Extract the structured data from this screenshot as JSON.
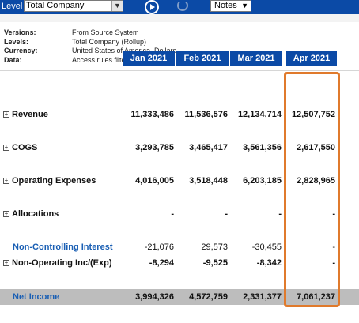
{
  "toolbar": {
    "level_label": "Level",
    "level_value": "Total Company",
    "notes_value": "Notes"
  },
  "meta": {
    "versions_key": "Versions:",
    "versions_val": "From Source System",
    "levels_key": "Levels:",
    "levels_val": "Total Company (Rollup)",
    "currency_key": "Currency:",
    "currency_val": "United States of America, Dollars",
    "data_key": "Data:",
    "data_val": "Access rules filter your data."
  },
  "columns": [
    "Jan 2021",
    "Feb 2021",
    "Mar 2021",
    "Apr 2021"
  ],
  "rows": [
    {
      "label": "Revenue",
      "values": [
        "11,333,486",
        "11,536,576",
        "12,134,714",
        "12,507,752"
      ]
    },
    {
      "label": "COGS",
      "values": [
        "3,293,785",
        "3,465,417",
        "3,561,356",
        "2,617,550"
      ]
    },
    {
      "label": "Operating Expenses",
      "values": [
        "4,016,005",
        "3,518,448",
        "6,203,185",
        "2,828,965"
      ]
    },
    {
      "label": "Allocations",
      "values": [
        "-",
        "-",
        "-",
        "-"
      ]
    },
    {
      "label": "Non-Controlling Interest",
      "values": [
        "-21,076",
        "29,573",
        "-30,455",
        "-"
      ]
    },
    {
      "label": "Non-Operating Inc/(Exp)",
      "values": [
        "-8,294",
        "-9,525",
        "-8,342",
        "-"
      ]
    }
  ],
  "net_income": {
    "label": "Net Income",
    "values": [
      "3,994,326",
      "4,572,759",
      "2,331,377",
      "7,061,237"
    ]
  },
  "icons": {
    "play": "play-circle-icon",
    "refresh": "refresh-icon",
    "expand": "plus-box-icon"
  },
  "colors": {
    "header_blue": "#0b4aa6",
    "highlight_orange": "#e07a2c",
    "link_blue": "#1a5fb4"
  }
}
